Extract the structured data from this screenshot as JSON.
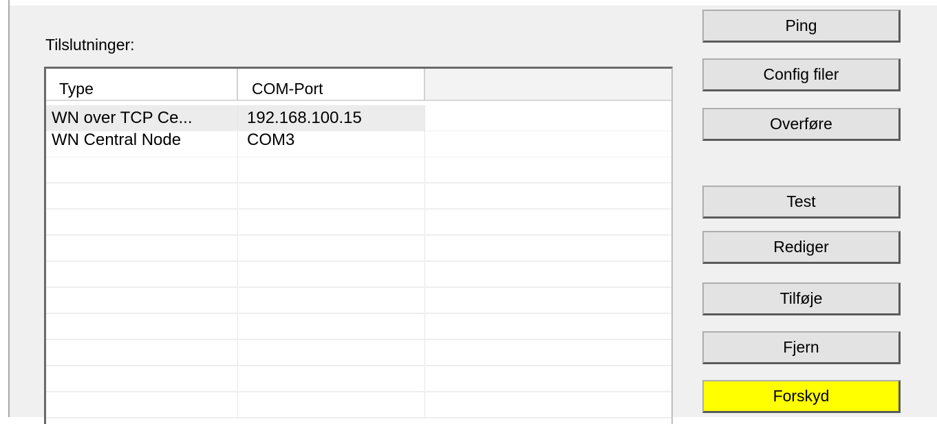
{
  "connections_label": "Tilslutninger:",
  "list": {
    "columns": [
      "Type",
      "COM-Port",
      ""
    ],
    "rows": [
      {
        "type": "WN over TCP Ce...",
        "com_port": "192.168.100.15"
      },
      {
        "type": "WN Central Node",
        "com_port": "COM3"
      }
    ]
  },
  "buttons": {
    "ping": "Ping",
    "config_files": "Config filer",
    "transfer": "Overføre",
    "test": "Test",
    "edit": "Rediger",
    "add": "Tilføje",
    "remove": "Fjern",
    "shift": "Forskyd"
  },
  "colors": {
    "shift_button_bg": "#ffff00",
    "dialog_bg": "#f0f0f0",
    "selected_row_bg": "#ececec"
  }
}
